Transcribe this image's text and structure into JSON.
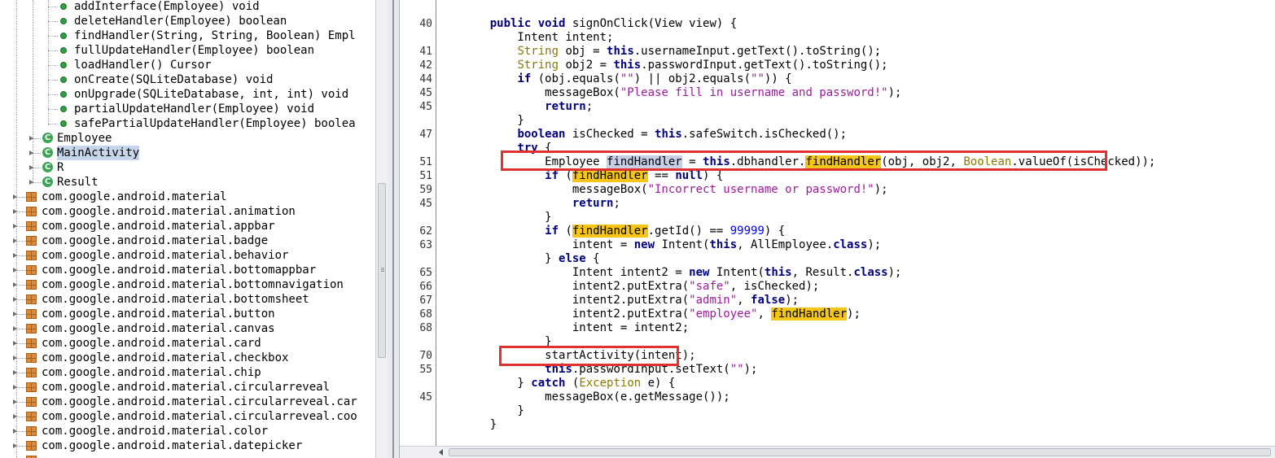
{
  "tree": {
    "methods": [
      {
        "label": "addInterface(Employee) void"
      },
      {
        "label": "deleteHandler(Employee) boolean"
      },
      {
        "label": "findHandler(String, String, Boolean) Empl"
      },
      {
        "label": "fullUpdateHandler(Employee) boolean"
      },
      {
        "label": "loadHandler() Cursor"
      },
      {
        "label": "onCreate(SQLiteDatabase) void"
      },
      {
        "label": "onUpgrade(SQLiteDatabase, int, int) void"
      },
      {
        "label": "partialUpdateHandler(Employee) void"
      },
      {
        "label": "safePartialUpdateHandler(Employee) boolea"
      }
    ],
    "classes": [
      {
        "label": "Employee",
        "icon": "class-icon"
      },
      {
        "label": "MainActivity",
        "icon": "class-icon",
        "selected": true
      },
      {
        "label": "R",
        "icon": "class-icon"
      },
      {
        "label": "Result",
        "icon": "class-icon"
      }
    ],
    "packages": [
      "com.google.android.material",
      "com.google.android.material.animation",
      "com.google.android.material.appbar",
      "com.google.android.material.badge",
      "com.google.android.material.behavior",
      "com.google.android.material.bottomappbar",
      "com.google.android.material.bottomnavigation",
      "com.google.android.material.bottomsheet",
      "com.google.android.material.button",
      "com.google.android.material.canvas",
      "com.google.android.material.card",
      "com.google.android.material.checkbox",
      "com.google.android.material.chip",
      "com.google.android.material.circularreveal",
      "com.google.android.material.circularreveal.car",
      "com.google.android.material.circularreveal.coo",
      "com.google.android.material.color",
      "com.google.android.material.datepicker"
    ]
  },
  "editor": {
    "line_numbers": [
      "40",
      "",
      "41",
      "42",
      "44",
      "45",
      "45",
      "",
      "47",
      "",
      "51",
      "51",
      "59",
      "45",
      "",
      "62",
      "63",
      "",
      "65",
      "66",
      "67",
      "68",
      "68",
      "",
      "70",
      "55",
      "",
      "45",
      "",
      "",
      ""
    ],
    "lines": [
      [
        {
          "t": "    "
        },
        {
          "t": "public",
          "c": "kw"
        },
        {
          "t": " "
        },
        {
          "t": "void",
          "c": "kw"
        },
        {
          "t": " signOnClick(View view) {"
        }
      ],
      [
        {
          "t": "        Intent intent;"
        }
      ],
      [
        {
          "t": "        "
        },
        {
          "t": "String",
          "c": "ty"
        },
        {
          "t": " obj = "
        },
        {
          "t": "this",
          "c": "kw"
        },
        {
          "t": ".usernameInput.getText().toString();"
        }
      ],
      [
        {
          "t": "        "
        },
        {
          "t": "String",
          "c": "ty"
        },
        {
          "t": " obj2 = "
        },
        {
          "t": "this",
          "c": "kw"
        },
        {
          "t": ".passwordInput.getText().toString();"
        }
      ],
      [
        {
          "t": "        "
        },
        {
          "t": "if",
          "c": "kw"
        },
        {
          "t": " (obj.equals("
        },
        {
          "t": "\"\"",
          "c": "st"
        },
        {
          "t": ") || obj2.equals("
        },
        {
          "t": "\"\"",
          "c": "st"
        },
        {
          "t": ")) {"
        }
      ],
      [
        {
          "t": "            messageBox("
        },
        {
          "t": "\"Please fill in username and password!\"",
          "c": "st"
        },
        {
          "t": ");"
        }
      ],
      [
        {
          "t": "            "
        },
        {
          "t": "return",
          "c": "kw"
        },
        {
          "t": ";"
        }
      ],
      [
        {
          "t": "        }"
        }
      ],
      [
        {
          "t": "        "
        },
        {
          "t": "boolean",
          "c": "kw"
        },
        {
          "t": " isChecked = "
        },
        {
          "t": "this",
          "c": "kw"
        },
        {
          "t": ".safeSwitch.isChecked();"
        }
      ],
      [
        {
          "t": "        "
        },
        {
          "t": "try",
          "c": "kw"
        },
        {
          "t": " {"
        }
      ],
      [
        {
          "t": "            Employee "
        },
        {
          "t": "findHandler",
          "c": "hl2"
        },
        {
          "t": " = "
        },
        {
          "t": "this",
          "c": "kw"
        },
        {
          "t": ".dbhandler."
        },
        {
          "t": "findHandler",
          "c": "hl"
        },
        {
          "t": "(obj, obj2, "
        },
        {
          "t": "Boolean",
          "c": "ty"
        },
        {
          "t": ".valueOf(isChecked));"
        }
      ],
      [
        {
          "t": "            "
        },
        {
          "t": "if",
          "c": "kw"
        },
        {
          "t": " ("
        },
        {
          "t": "findHandler",
          "c": "hl"
        },
        {
          "t": " == "
        },
        {
          "t": "null",
          "c": "kw"
        },
        {
          "t": ") {"
        }
      ],
      [
        {
          "t": "                messageBox("
        },
        {
          "t": "\"Incorrect username or password!\"",
          "c": "st"
        },
        {
          "t": ");"
        }
      ],
      [
        {
          "t": "                "
        },
        {
          "t": "return",
          "c": "kw"
        },
        {
          "t": ";"
        }
      ],
      [
        {
          "t": "            }"
        }
      ],
      [
        {
          "t": "            "
        },
        {
          "t": "if",
          "c": "kw"
        },
        {
          "t": " ("
        },
        {
          "t": "findHandler",
          "c": "hl"
        },
        {
          "t": ".getId() == "
        },
        {
          "t": "99999",
          "c": "nu"
        },
        {
          "t": ") {"
        }
      ],
      [
        {
          "t": "                intent = "
        },
        {
          "t": "new",
          "c": "kw"
        },
        {
          "t": " Intent("
        },
        {
          "t": "this",
          "c": "kw"
        },
        {
          "t": ", AllEmployee."
        },
        {
          "t": "class",
          "c": "kw"
        },
        {
          "t": ");"
        }
      ],
      [
        {
          "t": "            } "
        },
        {
          "t": "else",
          "c": "kw"
        },
        {
          "t": " {"
        }
      ],
      [
        {
          "t": "                Intent intent2 = "
        },
        {
          "t": "new",
          "c": "kw"
        },
        {
          "t": " Intent("
        },
        {
          "t": "this",
          "c": "kw"
        },
        {
          "t": ", Result."
        },
        {
          "t": "class",
          "c": "kw"
        },
        {
          "t": ");"
        }
      ],
      [
        {
          "t": "                intent2.putExtra("
        },
        {
          "t": "\"safe\"",
          "c": "st"
        },
        {
          "t": ", isChecked);"
        }
      ],
      [
        {
          "t": "                intent2.putExtra("
        },
        {
          "t": "\"admin\"",
          "c": "st"
        },
        {
          "t": ", "
        },
        {
          "t": "false",
          "c": "kw"
        },
        {
          "t": ");"
        }
      ],
      [
        {
          "t": "                intent2.putExtra("
        },
        {
          "t": "\"employee\"",
          "c": "st"
        },
        {
          "t": ", "
        },
        {
          "t": "findHandler",
          "c": "hl"
        },
        {
          "t": ");"
        }
      ],
      [
        {
          "t": "                intent = intent2;"
        }
      ],
      [
        {
          "t": "            }"
        }
      ],
      [
        {
          "t": "            startActivity(intent);"
        }
      ],
      [
        {
          "t": "            "
        },
        {
          "t": "this",
          "c": "kw"
        },
        {
          "t": ".passwordInput.setText("
        },
        {
          "t": "\"\"",
          "c": "st"
        },
        {
          "t": ");"
        }
      ],
      [
        {
          "t": "        } "
        },
        {
          "t": "catch",
          "c": "kw"
        },
        {
          "t": " ("
        },
        {
          "t": "Exception",
          "c": "ty"
        },
        {
          "t": " e) {"
        }
      ],
      [
        {
          "t": "            messageBox(e.getMessage());"
        }
      ],
      [
        {
          "t": "        }"
        }
      ],
      [
        {
          "t": "    }"
        }
      ],
      [
        {
          "t": ""
        }
      ]
    ]
  }
}
